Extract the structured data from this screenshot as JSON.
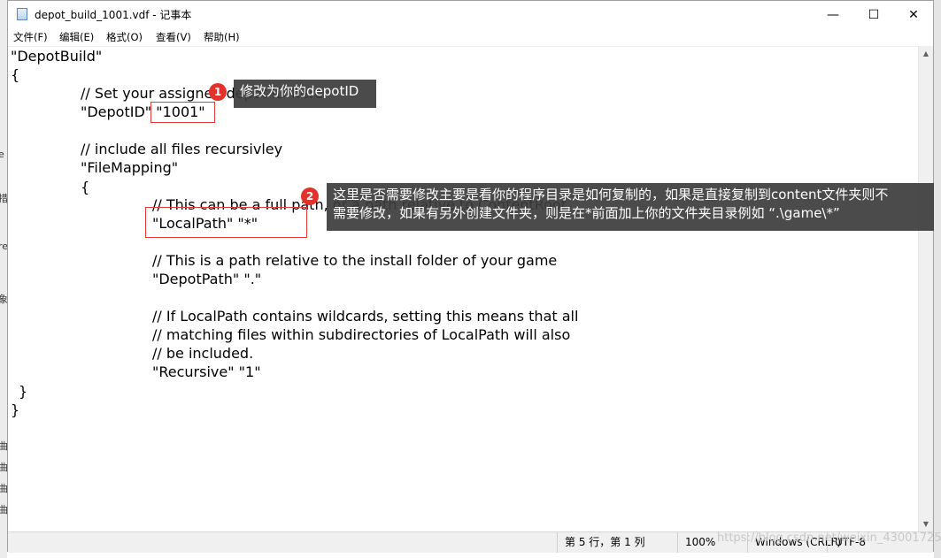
{
  "window": {
    "title": "depot_build_1001.vdf - 记事本",
    "minimize_glyph": "—",
    "maximize_glyph": "☐",
    "close_glyph": "✕"
  },
  "menu": [
    {
      "label": "文件(F)"
    },
    {
      "label": "编辑(E)"
    },
    {
      "label": "格式(O)"
    },
    {
      "label": "查看(V)"
    },
    {
      "label": "帮助(H)"
    }
  ],
  "editor": {
    "lines": [
      "\"DepotBuild\"",
      "{",
      "// Set your assigned depot ID here",
      "\"DepotID\" \"1001\"",
      "// include all files recursivley",
      "\"FileMapping\"",
      "{",
      "// This can be a full path, or a path relative to ContentRoot",
      "\"LocalPath\" \"*\"",
      "// This is a path relative to the install folder of your game",
      "\"DepotPath\" \".\"",
      "// If LocalPath contains wildcards, setting this means that all",
      "// matching files within subdirectories of LocalPath will also",
      "// be included.",
      "\"Recursive\" \"1\"",
      "}",
      "}"
    ]
  },
  "annotations": [
    {
      "number": "1",
      "text": "修改为你的depotID"
    },
    {
      "number": "2",
      "text_line1": "这里是否需要修改主要是看你的程序目录是如何复制的，如果是直接复制到content文件夹则不",
      "text_line2": "需要修改，如果有另外创建文件夹，则是在*前面加上你的文件夹目录例如 “.\\game\\*”"
    }
  ],
  "statusbar": {
    "position": "第 5 行，第 1 列",
    "zoom": "100%",
    "line_ending": "Windows (CRLF)",
    "encoding": "UTF-8"
  },
  "watermark": "https://blog.csdn.net/weixin_43001725"
}
